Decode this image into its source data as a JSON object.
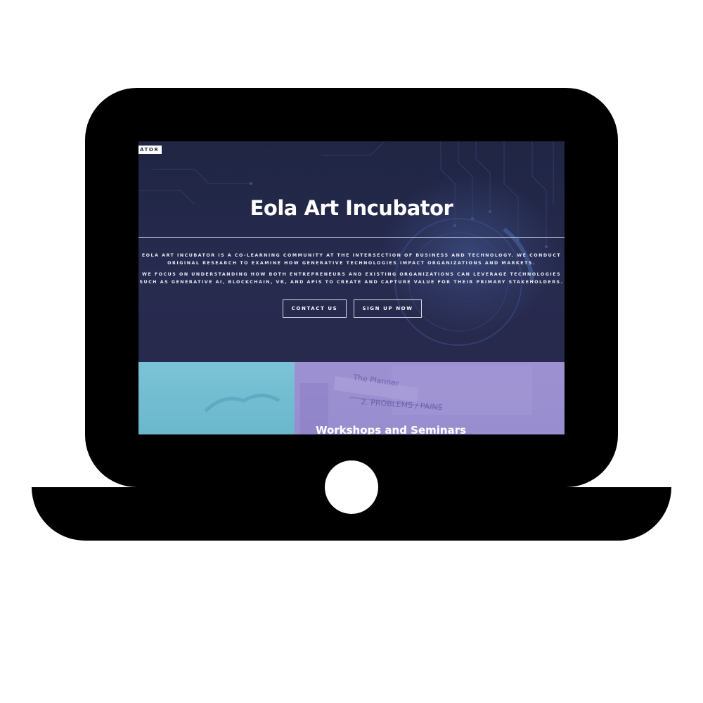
{
  "site": {
    "logo_text": "ATOR",
    "hero": {
      "title": "Eola Art Incubator",
      "description_1": "EOLA ART INCUBATOR IS A CO-LEARNING COMMUNITY AT THE INTERSECTION OF BUSINESS AND TECHNOLOGY. WE CONDUCT ORIGINAL RESEARCH TO EXAMINE HOW GENERATIVE TECHNOLOGIES IMPACT ORGANIZATIONS AND MARKETS.",
      "description_2": "WE FOCUS ON UNDERSTANDING HOW BOTH ENTREPRENEURS AND EXISTING ORGANIZATIONS CAN LEVERAGE TECHNOLOGIES SUCH AS GENERATIVE AI, BLOCKCHAIN, VR, AND APIS TO CREATE AND CAPTURE VALUE FOR THEIR PRIMARY STAKEHOLDERS.",
      "contact_button": "CONTACT US",
      "signup_button": "SIGN UP NOW"
    },
    "workshops": {
      "title": "Workshops and Seminars",
      "photo_text_1": "The Planner",
      "photo_text_2": "2. PROBLEMS / PAINS"
    }
  },
  "colors": {
    "frame": "#000000",
    "hero_bg": "#25294a",
    "accent_left": "#7cc3d6",
    "accent_right": "#9b8fd0"
  }
}
